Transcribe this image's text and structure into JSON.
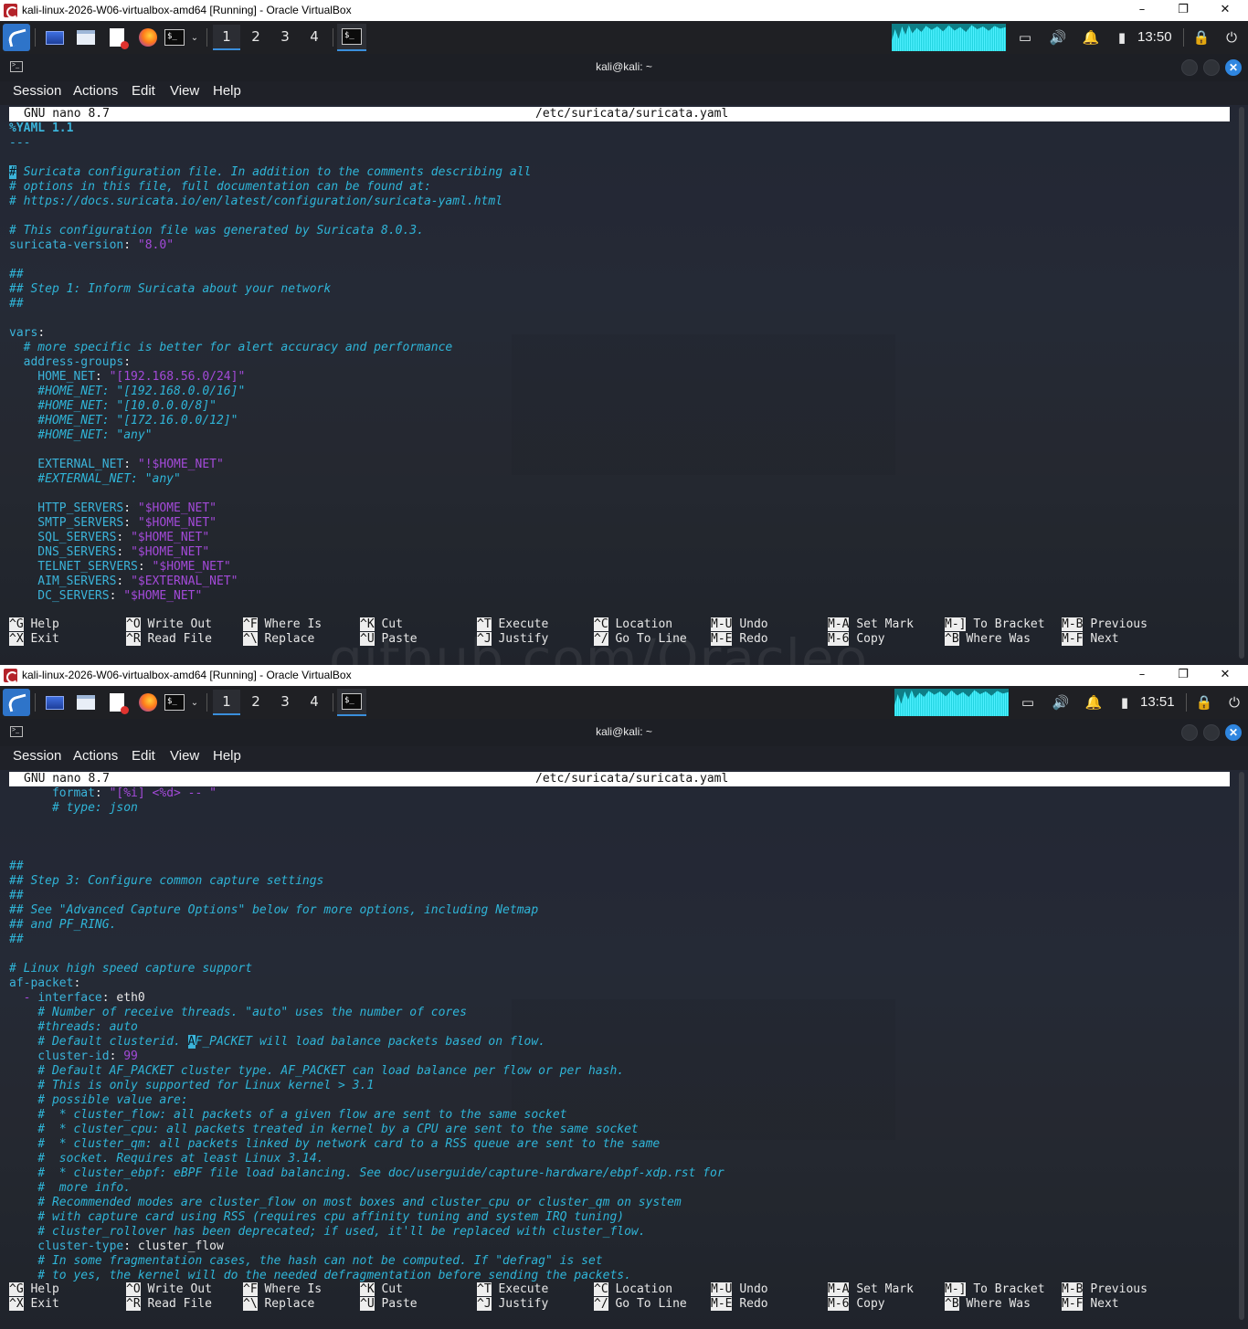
{
  "screens": [
    {
      "vb_title": "kali-linux-2026-W06-virtualbox-amd64 [Running] - Oracle VirtualBox",
      "workspaces": [
        "1",
        "2",
        "3",
        "4"
      ],
      "active_workspace": 0,
      "clock": "13:50",
      "terminal_title": "kali@kali: ~",
      "menu": [
        "Session",
        "Actions",
        "Edit",
        "View",
        "Help"
      ],
      "nano_version": "GNU nano 8.7",
      "file_path": "/etc/suricata/suricata.yaml",
      "lines": [
        [
          [
            "y",
            "%YAML 1.1"
          ]
        ],
        [
          [
            "dash",
            "---"
          ]
        ],
        [
          [
            "w",
            ""
          ]
        ],
        [
          [
            "cur",
            "#"
          ],
          [
            "c",
            " Suricata configuration file. In addition to the comments describing all"
          ]
        ],
        [
          [
            "c",
            "# options in this file, full documentation can be found at:"
          ]
        ],
        [
          [
            "c",
            "# https://docs.suricata.io/en/latest/configuration/suricata-yaml.html"
          ]
        ],
        [
          [
            "w",
            ""
          ]
        ],
        [
          [
            "c",
            "# This configuration file was generated by Suricata 8.0.3."
          ]
        ],
        [
          [
            "k",
            "suricata-version"
          ],
          [
            "w",
            ": "
          ],
          [
            "s",
            "\"8.0\""
          ]
        ],
        [
          [
            "w",
            ""
          ]
        ],
        [
          [
            "c",
            "##"
          ]
        ],
        [
          [
            "c",
            "## Step 1: Inform Suricata about your network"
          ]
        ],
        [
          [
            "c",
            "##"
          ]
        ],
        [
          [
            "w",
            ""
          ]
        ],
        [
          [
            "k",
            "vars"
          ],
          [
            "w",
            ":"
          ]
        ],
        [
          [
            "c",
            "  # more specific is better for alert accuracy and performance"
          ]
        ],
        [
          [
            "k",
            "  address-groups"
          ],
          [
            "w",
            ":"
          ]
        ],
        [
          [
            "k",
            "    HOME_NET"
          ],
          [
            "w",
            ": "
          ],
          [
            "s",
            "\"[192.168.56.0/24]\""
          ]
        ],
        [
          [
            "c",
            "    #HOME_NET: \"[192.168.0.0/16]\""
          ]
        ],
        [
          [
            "c",
            "    #HOME_NET: \"[10.0.0.0/8]\""
          ]
        ],
        [
          [
            "c",
            "    #HOME_NET: \"[172.16.0.0/12]\""
          ]
        ],
        [
          [
            "c",
            "    #HOME_NET: \"any\""
          ]
        ],
        [
          [
            "w",
            ""
          ]
        ],
        [
          [
            "k",
            "    EXTERNAL_NET"
          ],
          [
            "w",
            ": "
          ],
          [
            "s",
            "\"!$HOME_NET\""
          ]
        ],
        [
          [
            "c",
            "    #EXTERNAL_NET: \"any\""
          ]
        ],
        [
          [
            "w",
            ""
          ]
        ],
        [
          [
            "k",
            "    HTTP_SERVERS"
          ],
          [
            "w",
            ": "
          ],
          [
            "s",
            "\"$HOME_NET\""
          ]
        ],
        [
          [
            "k",
            "    SMTP_SERVERS"
          ],
          [
            "w",
            ": "
          ],
          [
            "s",
            "\"$HOME_NET\""
          ]
        ],
        [
          [
            "k",
            "    SQL_SERVERS"
          ],
          [
            "w",
            ": "
          ],
          [
            "s",
            "\"$HOME_NET\""
          ]
        ],
        [
          [
            "k",
            "    DNS_SERVERS"
          ],
          [
            "w",
            ": "
          ],
          [
            "s",
            "\"$HOME_NET\""
          ]
        ],
        [
          [
            "k",
            "    TELNET_SERVERS"
          ],
          [
            "w",
            ": "
          ],
          [
            "s",
            "\"$HOME_NET\""
          ]
        ],
        [
          [
            "k",
            "    AIM_SERVERS"
          ],
          [
            "w",
            ": "
          ],
          [
            "s",
            "\"$EXTERNAL_NET\""
          ]
        ],
        [
          [
            "k",
            "    DC_SERVERS"
          ],
          [
            "w",
            ": "
          ],
          [
            "s",
            "\"$HOME_NET\""
          ]
        ]
      ]
    },
    {
      "vb_title": "kali-linux-2026-W06-virtualbox-amd64 [Running] - Oracle VirtualBox",
      "workspaces": [
        "1",
        "2",
        "3",
        "4"
      ],
      "active_workspace": 0,
      "clock": "13:51",
      "terminal_title": "kali@kali: ~",
      "menu": [
        "Session",
        "Actions",
        "Edit",
        "View",
        "Help"
      ],
      "nano_version": "GNU nano 8.7",
      "file_path": "/etc/suricata/suricata.yaml",
      "lines": [
        [
          [
            "k",
            "      format"
          ],
          [
            "w",
            ": "
          ],
          [
            "s",
            "\"[%i] <%d> -- \""
          ]
        ],
        [
          [
            "c",
            "      # type: json"
          ]
        ],
        [
          [
            "w",
            ""
          ]
        ],
        [
          [
            "w",
            ""
          ]
        ],
        [
          [
            "w",
            ""
          ]
        ],
        [
          [
            "c",
            "##"
          ]
        ],
        [
          [
            "c",
            "## Step 3: Configure common capture settings"
          ]
        ],
        [
          [
            "c",
            "##"
          ]
        ],
        [
          [
            "c",
            "## See \"Advanced Capture Options\" below for more options, including Netmap"
          ]
        ],
        [
          [
            "c",
            "## and PF_RING."
          ]
        ],
        [
          [
            "c",
            "##"
          ]
        ],
        [
          [
            "w",
            ""
          ]
        ],
        [
          [
            "c",
            "# Linux high speed capture support"
          ]
        ],
        [
          [
            "k",
            "af-packet"
          ],
          [
            "w",
            ":"
          ]
        ],
        [
          [
            "s",
            "  - "
          ],
          [
            "k",
            "interface"
          ],
          [
            "w",
            ": eth0"
          ]
        ],
        [
          [
            "c",
            "    # Number of receive threads. \"auto\" uses the number of cores"
          ]
        ],
        [
          [
            "c",
            "    #threads: auto"
          ]
        ],
        [
          [
            "c",
            "    # Default clusterid. "
          ],
          [
            "cur",
            "A"
          ],
          [
            "c",
            "F_PACKET will load balance packets based on flow."
          ]
        ],
        [
          [
            "k",
            "    cluster-id"
          ],
          [
            "w",
            ": "
          ],
          [
            "s",
            "99"
          ]
        ],
        [
          [
            "c",
            "    # Default AF_PACKET cluster type. AF_PACKET can load balance per flow or per hash."
          ]
        ],
        [
          [
            "c",
            "    # This is only supported for Linux kernel > 3.1"
          ]
        ],
        [
          [
            "c",
            "    # possible value are:"
          ]
        ],
        [
          [
            "c",
            "    #  * cluster_flow: all packets of a given flow are sent to the same socket"
          ]
        ],
        [
          [
            "c",
            "    #  * cluster_cpu: all packets treated in kernel by a CPU are sent to the same socket"
          ]
        ],
        [
          [
            "c",
            "    #  * cluster_qm: all packets linked by network card to a RSS queue are sent to the same"
          ]
        ],
        [
          [
            "c",
            "    #  socket. Requires at least Linux 3.14."
          ]
        ],
        [
          [
            "c",
            "    #  * cluster_ebpf: eBPF file load balancing. See doc/userguide/capture-hardware/ebpf-xdp.rst for"
          ]
        ],
        [
          [
            "c",
            "    #  more info."
          ]
        ],
        [
          [
            "c",
            "    # Recommended modes are cluster_flow on most boxes and cluster_cpu or cluster_qm on system"
          ]
        ],
        [
          [
            "c",
            "    # with capture card using RSS (requires cpu affinity tuning and system IRQ tuning)"
          ]
        ],
        [
          [
            "c",
            "    # cluster_rollover has been deprecated; if used, it'll be replaced with cluster_flow."
          ]
        ],
        [
          [
            "k",
            "    cluster-type"
          ],
          [
            "w",
            ": cluster_flow"
          ]
        ],
        [
          [
            "c",
            "    # In some fragmentation cases, the hash can not be computed. If \"defrag\" is set"
          ]
        ],
        [
          [
            "c",
            "    # to yes, the kernel will do the needed defragmentation before sending the packets."
          ]
        ]
      ]
    }
  ],
  "shortcuts": [
    [
      {
        "key": "^G",
        "label": "Help"
      },
      {
        "key": "^X",
        "label": "Exit"
      }
    ],
    [
      {
        "key": "^O",
        "label": "Write Out"
      },
      {
        "key": "^R",
        "label": "Read File"
      }
    ],
    [
      {
        "key": "^F",
        "label": "Where Is"
      },
      {
        "key": "^\\",
        "label": "Replace"
      }
    ],
    [
      {
        "key": "^K",
        "label": "Cut"
      },
      {
        "key": "^U",
        "label": "Paste"
      }
    ],
    [
      {
        "key": "^T",
        "label": "Execute"
      },
      {
        "key": "^J",
        "label": "Justify"
      }
    ],
    [
      {
        "key": "^C",
        "label": "Location"
      },
      {
        "key": "^/",
        "label": "Go To Line"
      }
    ],
    [
      {
        "key": "M-U",
        "label": "Undo"
      },
      {
        "key": "M-E",
        "label": "Redo"
      }
    ],
    [
      {
        "key": "M-A",
        "label": "Set Mark"
      },
      {
        "key": "M-6",
        "label": "Copy"
      }
    ],
    [
      {
        "key": "M-]",
        "label": "To Bracket"
      },
      {
        "key": "^B",
        "label": "Where Was"
      }
    ],
    [
      {
        "key": "M-B",
        "label": "Previous"
      },
      {
        "key": "M-F",
        "label": "Next"
      }
    ]
  ],
  "watermark": "github.com/Oracleo",
  "icons": [
    "kali-menu-icon",
    "desktop-icon",
    "file-manager-icon",
    "text-editor-icon",
    "firefox-icon",
    "terminal-icon",
    "display-icon",
    "volume-icon",
    "bell-icon",
    "battery-icon",
    "lock-icon",
    "power-icon"
  ]
}
